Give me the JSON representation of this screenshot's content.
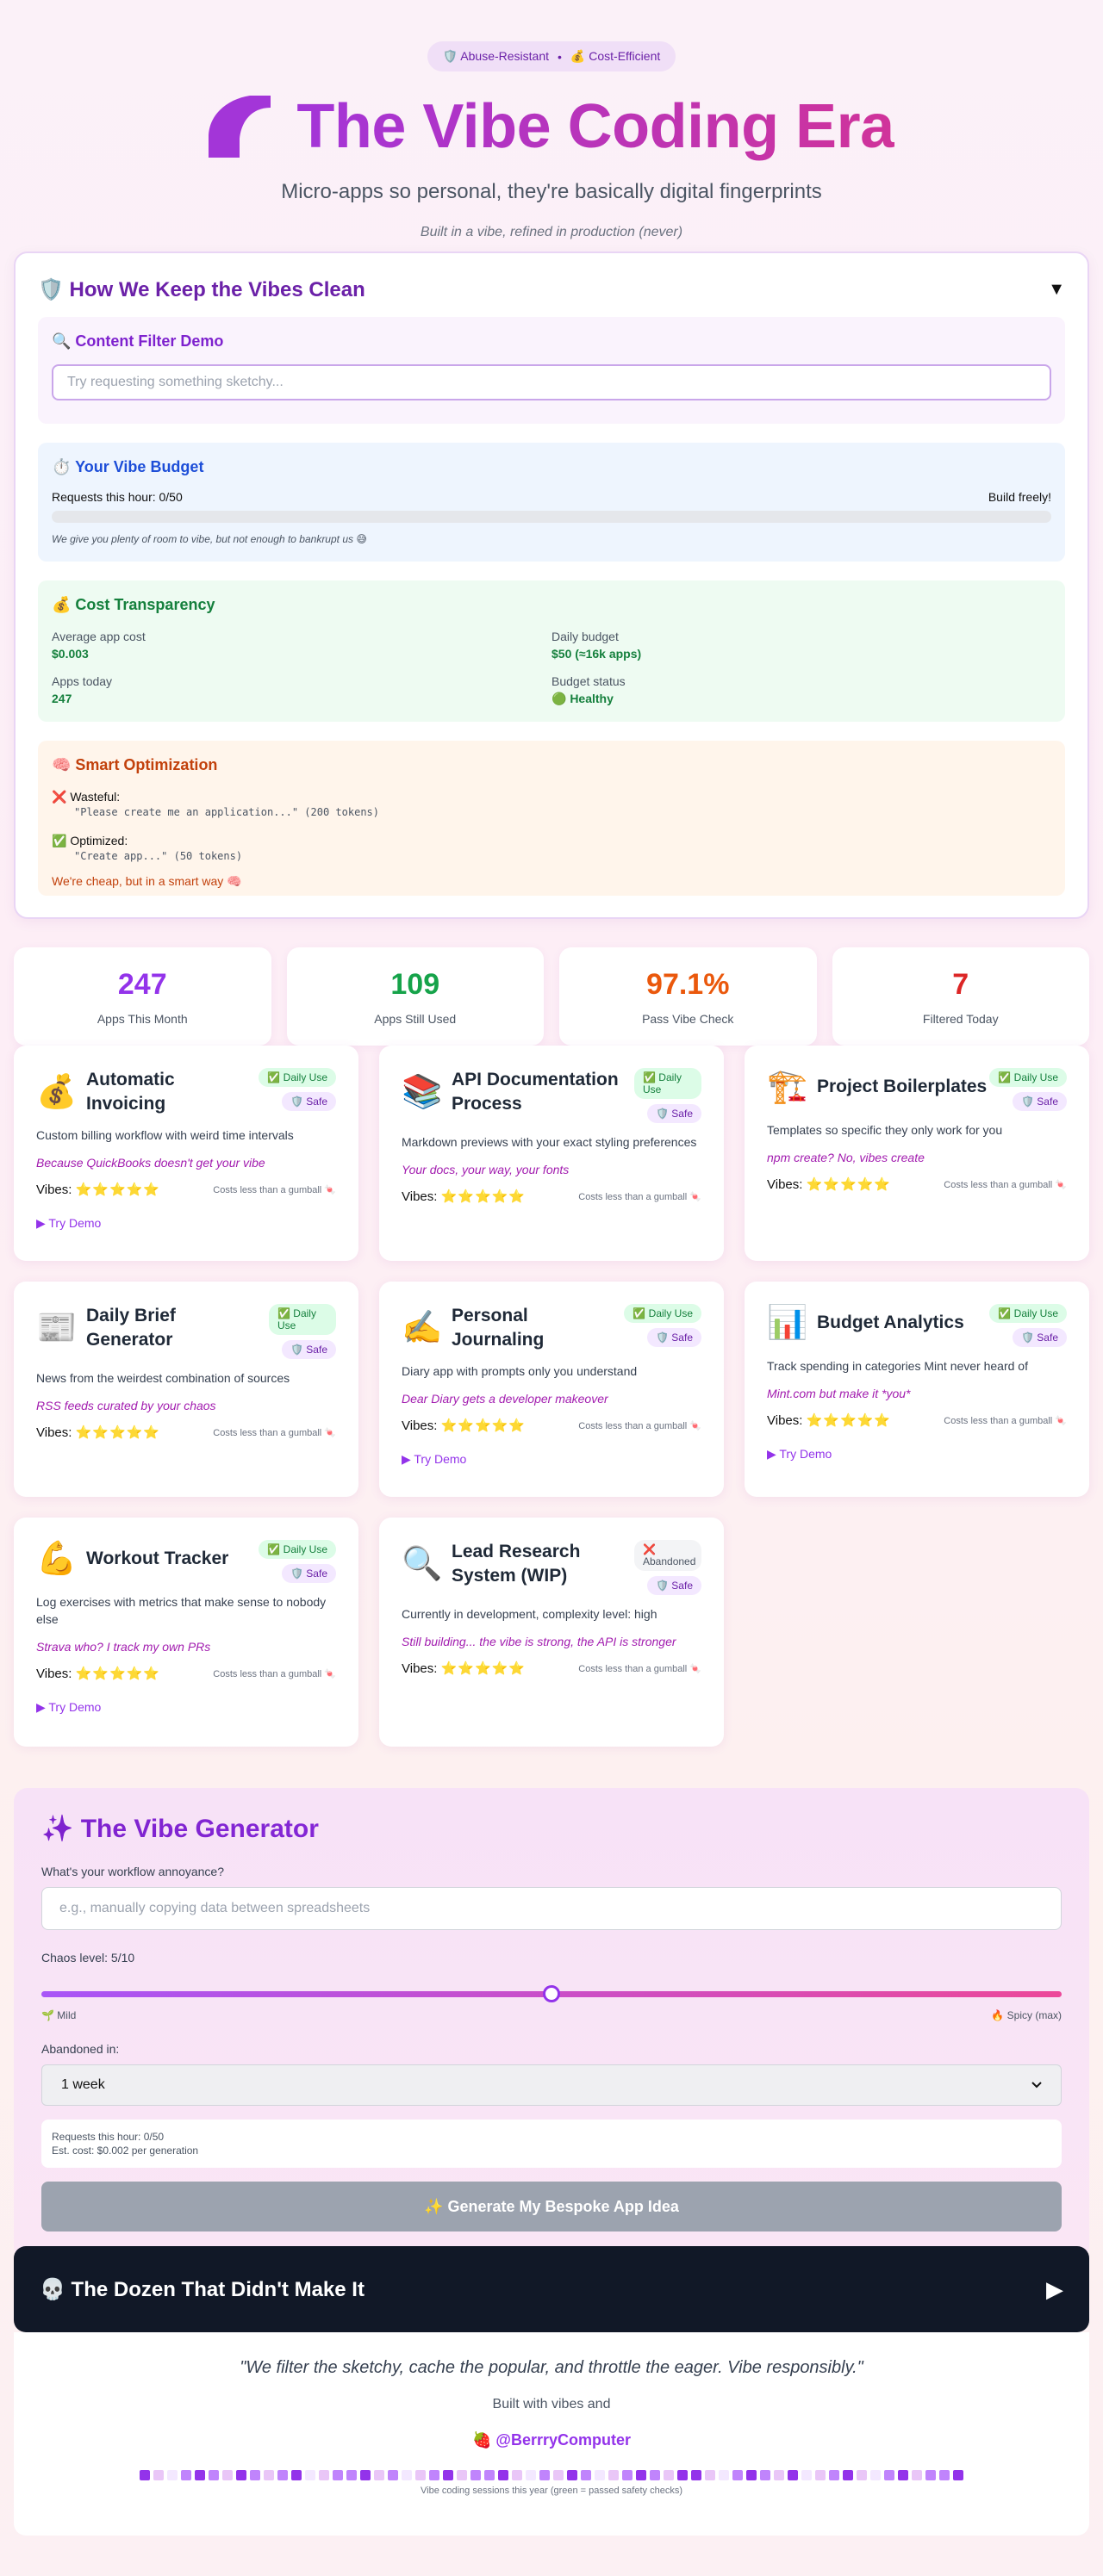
{
  "hero": {
    "badge_left": "🛡️ Abuse-Resistant",
    "badge_sep": "•",
    "badge_right": "💰 Cost-Efficient",
    "title": "The Vibe Coding Era",
    "subtitle": "Micro-apps so personal, they're basically digital fingerprints",
    "tagline": "Built in a vibe, refined in production (never)"
  },
  "safety": {
    "title": "🛡️ How We Keep the Vibes Clean",
    "toggle": "▼",
    "filter": {
      "title": "🔍 Content Filter Demo",
      "placeholder": "Try requesting something sketchy..."
    },
    "budget": {
      "title": "⏱️ Your Vibe Budget",
      "requests": "Requests this hour: 0/50",
      "status": "Build freely!",
      "progress": 0,
      "note": "We give you plenty of room to vibe, but not enough to bankrupt us 😅"
    },
    "cost": {
      "title": "💰 Cost Transparency",
      "items": [
        {
          "label": "Average app cost",
          "value": "$0.003"
        },
        {
          "label": "Daily budget",
          "value": "$50 (≈16k apps)"
        },
        {
          "label": "Apps today",
          "value": "247"
        },
        {
          "label": "Budget status",
          "value": "🟢 Healthy"
        }
      ]
    },
    "optimization": {
      "title": "🧠 Smart Optimization",
      "wasteful_label": "❌  Wasteful:",
      "wasteful_code": "\"Please create me an application...\" (200 tokens)",
      "optimized_label": "✅  Optimized:",
      "optimized_code": "\"Create app...\" (50 tokens)",
      "footer": "We're cheap, but in a smart way 🧠"
    }
  },
  "stats": [
    {
      "value": "247",
      "label": "Apps This Month",
      "color": "#9333ea"
    },
    {
      "value": "109",
      "label": "Apps Still Used",
      "color": "#16a34a"
    },
    {
      "value": "97.1%",
      "label": "Pass Vibe Check",
      "color": "#ea580c"
    },
    {
      "value": "7",
      "label": "Filtered Today",
      "color": "#dc2626"
    }
  ],
  "cards": [
    {
      "icon": "💰",
      "title": "Automatic Invoicing",
      "status": "✅ Daily Use",
      "safe": "🛡️ Safe",
      "desc": "Custom billing workflow with weird time intervals",
      "quote": "Because QuickBooks doesn't get your vibe",
      "vibes": "Vibes:",
      "stars": "⭐⭐⭐⭐⭐",
      "cost": "Costs less than a gumball 🍬",
      "link": "▶ Try Demo"
    },
    {
      "icon": "📚",
      "title": "API Documentation Process",
      "status": "✅ Daily Use",
      "safe": "🛡️ Safe",
      "desc": "Markdown previews with your exact styling preferences",
      "quote": "Your docs, your way, your fonts",
      "vibes": "Vibes:",
      "stars": "⭐⭐⭐⭐⭐",
      "cost": "Costs less than a gumball 🍬",
      "link": ""
    },
    {
      "icon": "🏗️",
      "title": "Project Boilerplates",
      "status": "✅ Daily Use",
      "safe": "🛡️ Safe",
      "desc": "Templates so specific they only work for you",
      "quote": "npm create? No, vibes create",
      "vibes": "Vibes:",
      "stars": "⭐⭐⭐⭐⭐",
      "cost": "Costs less than a gumball 🍬",
      "link": ""
    },
    {
      "icon": "📰",
      "title": "Daily Brief Generator",
      "status": "✅ Daily Use",
      "safe": "🛡️ Safe",
      "desc": "News from the weirdest combination of sources",
      "quote": "RSS feeds curated by your chaos",
      "vibes": "Vibes:",
      "stars": "⭐⭐⭐⭐⭐",
      "cost": "Costs less than a gumball 🍬",
      "link": ""
    },
    {
      "icon": "✍️",
      "title": "Personal Journaling",
      "status": "✅ Daily Use",
      "safe": "🛡️ Safe",
      "desc": "Diary app with prompts only you understand",
      "quote": "Dear Diary gets a developer makeover",
      "vibes": "Vibes:",
      "stars": "⭐⭐⭐⭐⭐",
      "cost": "Costs less than a gumball 🍬",
      "link": "▶ Try Demo"
    },
    {
      "icon": "📊",
      "title": "Budget Analytics",
      "status": "✅ Daily Use",
      "safe": "🛡️ Safe",
      "desc": "Track spending in categories Mint never heard of",
      "quote": "Mint.com but make it *you*",
      "vibes": "Vibes:",
      "stars": "⭐⭐⭐⭐⭐",
      "cost": "Costs less than a gumball 🍬",
      "link": "▶ Try Demo"
    },
    {
      "icon": "💪",
      "title": "Workout Tracker",
      "status": "✅ Daily Use",
      "safe": "🛡️ Safe",
      "desc": "Log exercises with metrics that make sense to nobody else",
      "quote": "Strava who? I track my own PRs",
      "vibes": "Vibes:",
      "stars": "⭐⭐⭐⭐⭐",
      "cost": "Costs less than a gumball 🍬",
      "link": "▶ Try Demo"
    },
    {
      "icon": "🔍",
      "title": "Lead Research System (WIP)",
      "status": "❌ Abandoned",
      "safe": "🛡️ Safe",
      "desc": "Currently in development, complexity level: high",
      "quote": "Still building... the vibe is strong, the API is stronger",
      "vibes": "Vibes:",
      "stars": "⭐⭐⭐⭐⭐",
      "cost": "Costs less than a gumball 🍬",
      "link": ""
    }
  ],
  "generator": {
    "title": "✨ The Vibe Generator",
    "question": "What's your workflow annoyance?",
    "placeholder": "e.g., manually copying data between spreadsheets",
    "chaos_label": "Chaos level: 5/10",
    "chaos_value": 5,
    "chaos_max": 10,
    "mild": "🌱 Mild",
    "spicy": "🔥 Spicy (max)",
    "abandoned_label": "Abandoned in:",
    "abandoned_value": "1 week",
    "info_requests": "Requests this hour: 0/50",
    "info_cost": "Est. cost: $0.002 per generation",
    "button": "✨ Generate My Bespoke App Idea"
  },
  "graveyard": {
    "title": "💀 The Dozen That Didn't Make It",
    "toggle": "▶"
  },
  "footer": {
    "quote": "\"We filter the sketchy, cache the popular, and throttle the eager. Vibe responsibly.\"",
    "built": "Built with vibes and",
    "handle": "🍓 @BerrryComputer",
    "caption": "Vibe coding sessions this year (green = passed safety checks)",
    "heatmap": [
      3,
      1,
      0,
      2,
      3,
      2,
      1,
      3,
      2,
      1,
      2,
      3,
      0,
      1,
      2,
      2,
      3,
      1,
      2,
      0,
      1,
      2,
      3,
      1,
      2,
      2,
      3,
      1,
      0,
      2,
      1,
      3,
      2,
      0,
      1,
      2,
      3,
      2,
      1,
      3,
      3,
      1,
      0,
      2,
      3,
      2,
      1,
      3,
      0,
      1,
      2,
      3,
      1,
      0,
      2,
      3,
      1,
      2,
      2,
      3
    ]
  }
}
